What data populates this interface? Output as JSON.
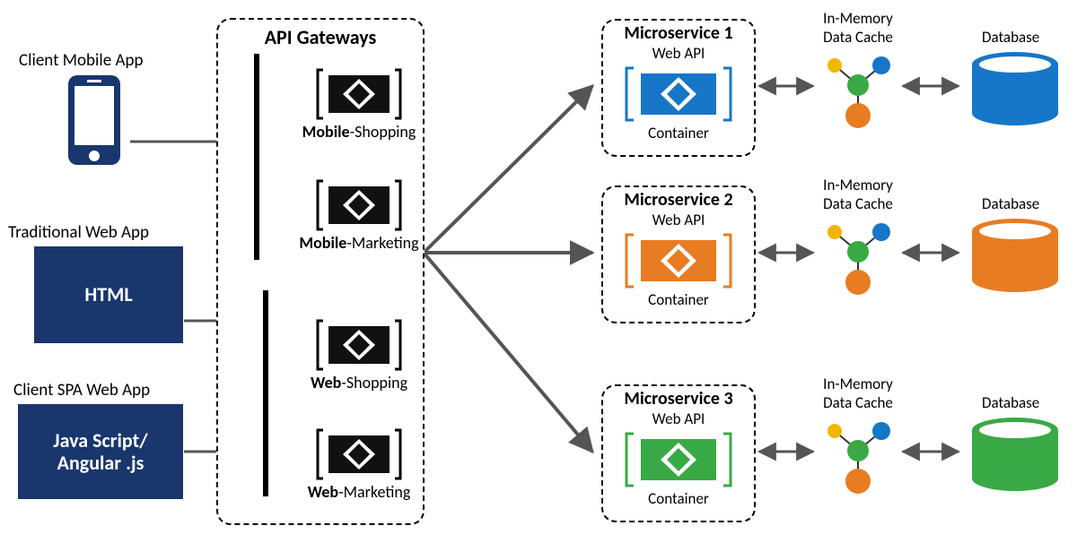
{
  "clients": {
    "mobile": {
      "label": "Client Mobile App"
    },
    "web": {
      "label": "Traditional Web App",
      "box": "HTML"
    },
    "spa": {
      "label": "Client SPA Web App",
      "box_line1": "Java Script/",
      "box_line2": "Angular .js"
    }
  },
  "gateways": {
    "title": "API Gateways",
    "items": [
      {
        "bold": "Mobile",
        "rest": "-Shopping"
      },
      {
        "bold": "Mobile",
        "rest": "-Marketing"
      },
      {
        "bold": "Web",
        "rest": "-Shopping"
      },
      {
        "bold": "Web",
        "rest": "-Marketing"
      }
    ]
  },
  "microservices": [
    {
      "title": "Microservice 1",
      "api": "Web API",
      "container": "Container",
      "color": "#1676c7"
    },
    {
      "title": "Microservice 2",
      "api": "Web API",
      "container": "Container",
      "color": "#e87c22"
    },
    {
      "title": "Microservice 3",
      "api": "Web API",
      "container": "Container",
      "color": "#39a946"
    }
  ],
  "right": {
    "cache_line1": "In-Memory",
    "cache_line2": "Data Cache",
    "db": "Database"
  }
}
